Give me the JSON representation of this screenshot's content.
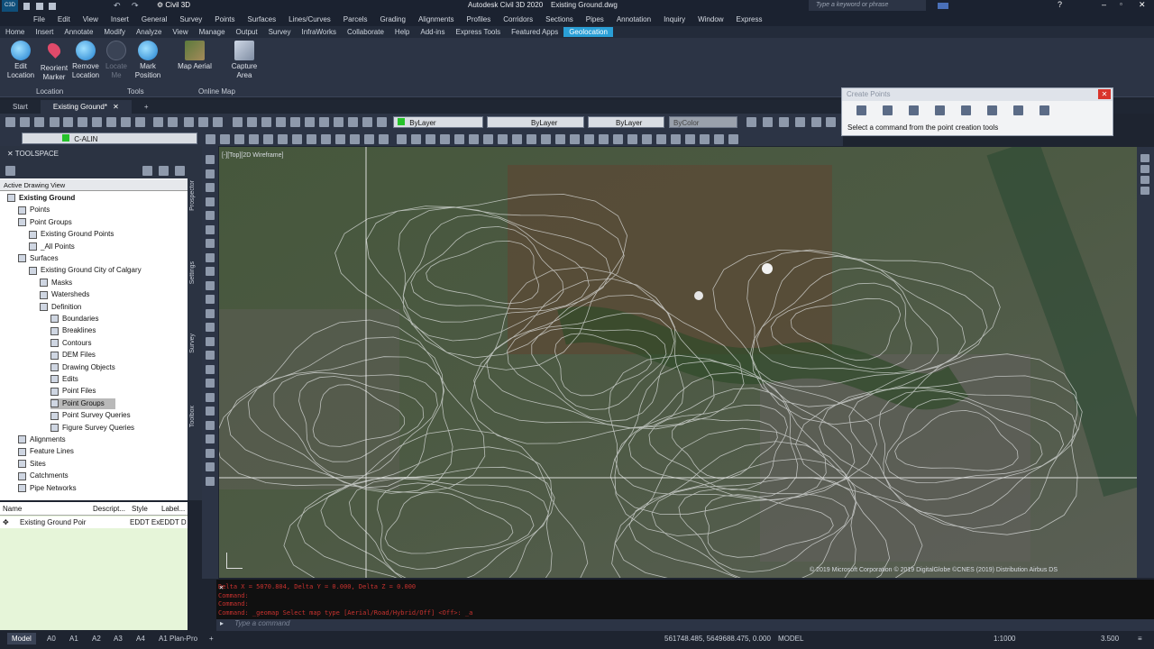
{
  "titlebar": {
    "workspace": "Civil 3D",
    "app_title": "Autodesk Civil 3D 2020",
    "file_name": "Existing Ground.dwg",
    "search_placeholder": "Type a keyword or phrase"
  },
  "menu": [
    "File",
    "Edit",
    "View",
    "Insert",
    "General",
    "Survey",
    "Points",
    "Surfaces",
    "Lines/Curves",
    "Parcels",
    "Grading",
    "Alignments",
    "Profiles",
    "Corridors",
    "Sections",
    "Pipes",
    "Annotation",
    "Inquiry",
    "Window",
    "Express"
  ],
  "ribbon_tabs": [
    "Home",
    "Insert",
    "Annotate",
    "Modify",
    "Analyze",
    "View",
    "Manage",
    "Output",
    "Survey",
    "InfraWorks",
    "Collaborate",
    "Help",
    "Add-ins",
    "Express Tools",
    "Featured Apps",
    "Geolocation"
  ],
  "active_ribbon_tab": "Geolocation",
  "ribbon": {
    "buttons": [
      {
        "label1": "Edit",
        "label2": "Location"
      },
      {
        "label1": "Reorient",
        "label2": "Marker"
      },
      {
        "label1": "Remove",
        "label2": "Location"
      },
      {
        "label1": "Locate",
        "label2": "Me"
      },
      {
        "label1": "Mark",
        "label2": "Position"
      },
      {
        "label1": "Map Aerial",
        "label2": ""
      },
      {
        "label1": "Capture",
        "label2": "Area"
      }
    ],
    "panels": [
      "Location",
      "Tools",
      "Online Map"
    ]
  },
  "doc_tabs": [
    "Start",
    "Existing Ground*"
  ],
  "toolbar": {
    "layer1": "ByLayer",
    "linetype": "ByLayer",
    "lineweight": "ByLayer",
    "color": "ByColor",
    "layer_name": "C-ALIN"
  },
  "toolspace": {
    "title": "TOOLSPACE",
    "view": "Active Drawing View",
    "tree": [
      "Existing Ground",
      "Points",
      "Point Groups",
      "Existing Ground Points",
      "_All Points",
      "Surfaces",
      "Existing Ground City of Calgary",
      "Masks",
      "Watersheds",
      "Definition",
      "Boundaries",
      "Breaklines",
      "Contours",
      "DEM Files",
      "Drawing Objects",
      "Edits",
      "Point Files",
      "Point Groups",
      "Point Survey Queries",
      "Figure Survey Queries",
      "Alignments",
      "Feature Lines",
      "Sites",
      "Catchments",
      "Pipe Networks"
    ],
    "side_tabs": [
      "Prospector",
      "Settings",
      "Survey",
      "Toolbox"
    ]
  },
  "list": {
    "columns": [
      "Name",
      "Descript...",
      "Style",
      "Label..."
    ],
    "row": {
      "name": "Existing Ground Poir",
      "style": "EDDT Ex",
      "label": "EDDT D"
    }
  },
  "viewport_label": "[-][Top][2D Wireframe]",
  "map_credit": "© 2019 Microsoft Corporation © 2019 DigitalGlobe ©CNES (2019) Distribution Airbus DS",
  "create_points": {
    "title": "Create Points",
    "prompt": "Select a command from the point creation tools"
  },
  "command": {
    "lines": [
      "Delta X = 5070.804,  Delta Y = 0.000,   Delta Z = 0.000",
      "Command:",
      "Command:",
      "Command: _geomap Select map type [Aerial/Road/Hybrid/Off] <Off>: _a"
    ],
    "placeholder": "Type a command"
  },
  "status": {
    "layout_tabs": [
      "Model",
      "A0",
      "A1",
      "A2",
      "A3",
      "A4",
      "A1 Plan-Pro"
    ],
    "coords": "561748.485, 5649688.475, 0.000",
    "mode": "MODEL",
    "scale": "1:1000",
    "value": "3.500"
  }
}
